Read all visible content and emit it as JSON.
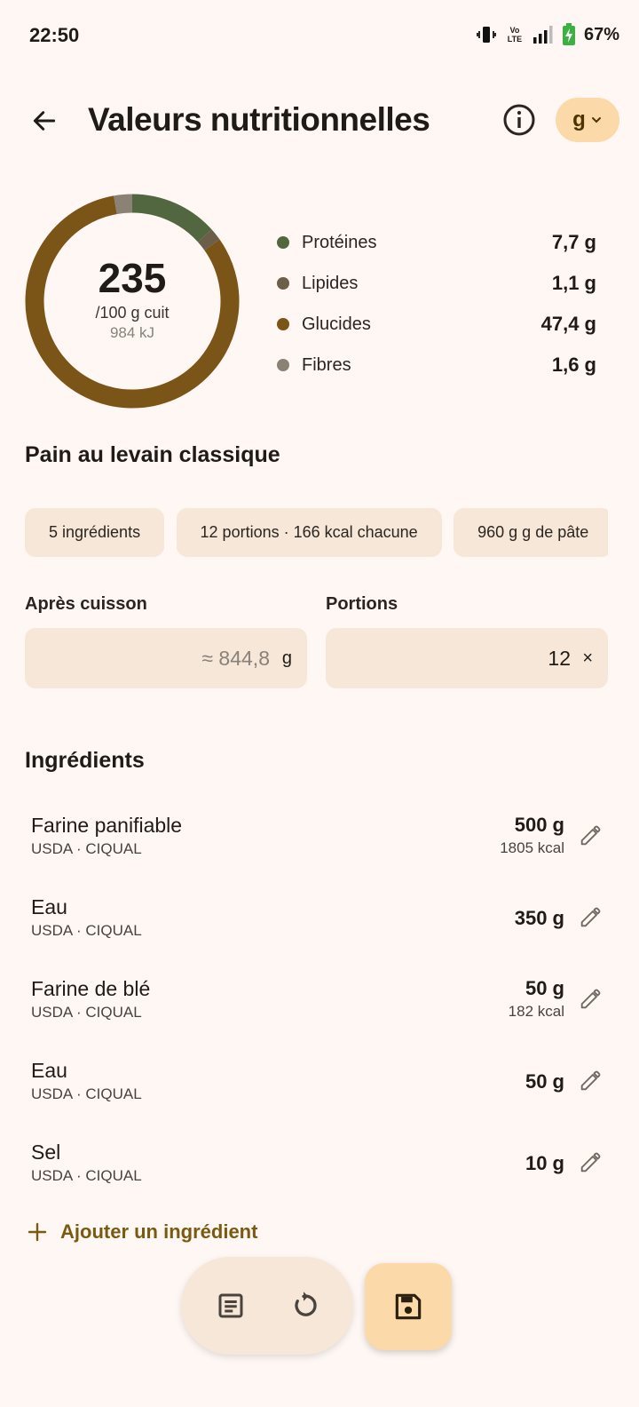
{
  "status_bar": {
    "time": "22:50",
    "network_label": "Vo LTE",
    "battery": "67%"
  },
  "header": {
    "title": "Valeurs nutritionnelles",
    "unit_selector": "g"
  },
  "summary": {
    "kcal": "235",
    "per_label": "/100 g cuit",
    "kj": "984 kJ",
    "macros": [
      {
        "name": "Protéines",
        "value": "7,7 g",
        "color": "#52673f"
      },
      {
        "name": "Lipides",
        "value": "1,1 g",
        "color": "#6b5f4a"
      },
      {
        "name": "Glucides",
        "value": "47,4 g",
        "color": "#7b5418"
      },
      {
        "name": "Fibres",
        "value": "1,6 g",
        "color": "#8b8174"
      }
    ]
  },
  "recipe": {
    "name": "Pain au levain classique",
    "chips": [
      "5 ingrédients",
      "12 portions · 166 kcal chacune",
      "960 g g de pâte"
    ]
  },
  "fields": {
    "after_cooking": {
      "label": "Après cuisson",
      "value": "≈ 844,8",
      "suffix": "g"
    },
    "portions": {
      "label": "Portions",
      "value": "12",
      "suffix": "×"
    }
  },
  "ingredients": {
    "title": "Ingrédients",
    "items": [
      {
        "name": "Farine panifiable",
        "source": "USDA · CIQUAL",
        "qty": "500 g",
        "kcal": "1805 kcal"
      },
      {
        "name": "Eau",
        "source": "USDA · CIQUAL",
        "qty": "350 g",
        "kcal": ""
      },
      {
        "name": "Farine de blé",
        "source": "USDA · CIQUAL",
        "qty": "50 g",
        "kcal": "182 kcal"
      },
      {
        "name": "Eau",
        "source": "USDA · CIQUAL",
        "qty": "50 g",
        "kcal": ""
      },
      {
        "name": "Sel",
        "source": "USDA · CIQUAL",
        "qty": "10 g",
        "kcal": ""
      }
    ],
    "add_label": "Ajouter un ingrédient"
  },
  "icons": {
    "back": "arrow-back-icon",
    "info": "info-icon",
    "dropdown": "chevron-down-icon",
    "edit": "pencil-icon",
    "add": "plus-icon",
    "notes": "notes-icon",
    "reset": "refresh-icon",
    "save": "save-icon"
  },
  "colors": {
    "accent": "#fcd9a8",
    "surface": "#f6e7d8",
    "background": "#fff7f3",
    "add_text": "#7a5a10"
  }
}
